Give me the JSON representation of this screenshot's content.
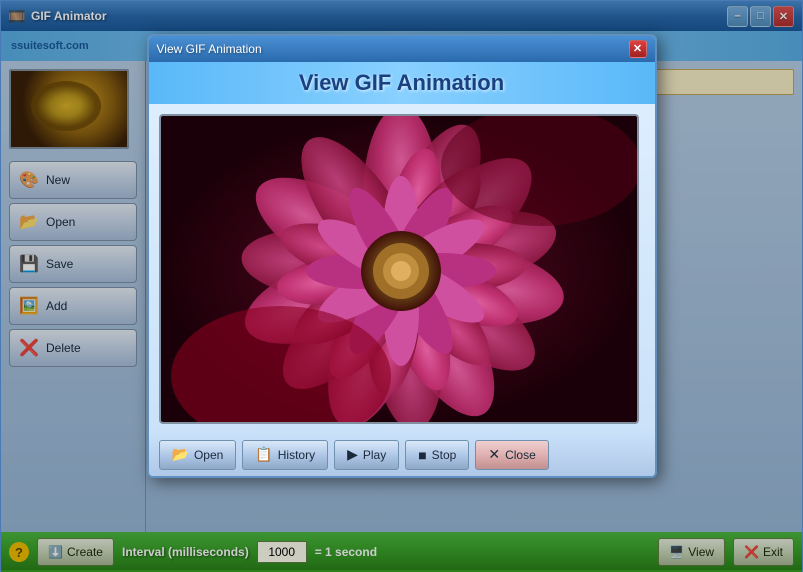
{
  "app": {
    "title": "GIF Animator",
    "brand": "ssuitesoft.com"
  },
  "titlebar": {
    "minimize_label": "–",
    "maximize_label": "□",
    "close_label": "✕"
  },
  "sidebar": {
    "buttons": [
      {
        "id": "new",
        "label": "New",
        "icon": "🎨"
      },
      {
        "id": "open",
        "label": "Open",
        "icon": "📂"
      },
      {
        "id": "save",
        "label": "Save",
        "icon": "💾"
      },
      {
        "id": "add",
        "label": "Add",
        "icon": "🖼️"
      },
      {
        "id": "delete",
        "label": "Delete",
        "icon": "❌"
      }
    ]
  },
  "bottom": {
    "help_label": "?",
    "create_label": "Create",
    "interval_label": "Interval (milliseconds)",
    "interval_value": "1000",
    "interval_eq": "= 1 second",
    "view_label": "View",
    "exit_label": "Exit"
  },
  "modal": {
    "title": "View GIF Animation",
    "header_title": "View GIF Animation",
    "close_label": "✕",
    "buttons": [
      {
        "id": "open",
        "label": "Open",
        "icon": "📂"
      },
      {
        "id": "history",
        "label": "History",
        "icon": "📋"
      },
      {
        "id": "play",
        "label": "Play",
        "icon": "▶"
      },
      {
        "id": "stop",
        "label": "Stop",
        "icon": "■"
      },
      {
        "id": "close",
        "label": "Close",
        "icon": "✕"
      }
    ]
  }
}
